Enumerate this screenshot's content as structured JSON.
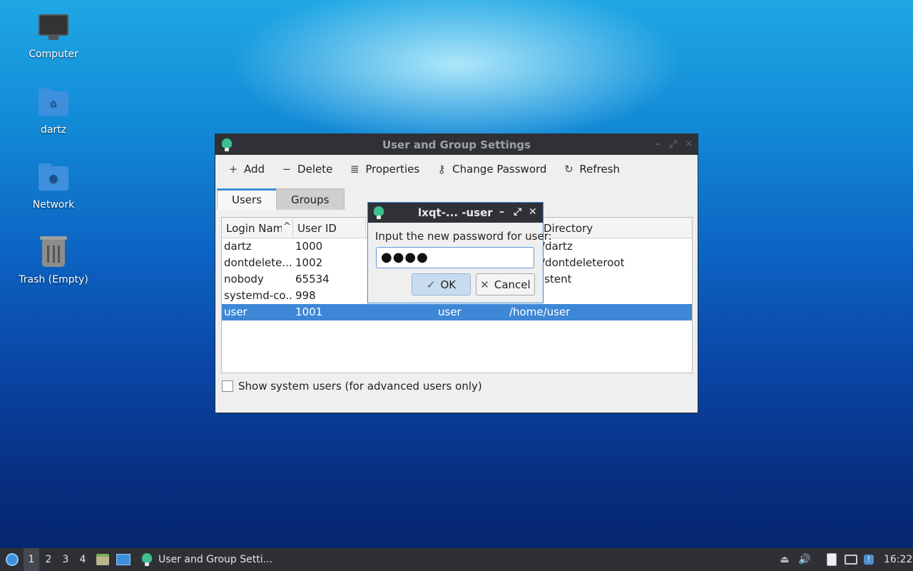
{
  "desktop": {
    "icons": [
      {
        "label": "Computer"
      },
      {
        "label": "dartz"
      },
      {
        "label": "Network"
      },
      {
        "label": "Trash (Empty)"
      }
    ]
  },
  "window": {
    "title": "User and Group Settings",
    "toolbar": {
      "add": "Add",
      "delete": "Delete",
      "properties": "Properties",
      "change_password": "Change Password",
      "refresh": "Refresh"
    },
    "tabs": [
      {
        "label": "Users",
        "active": true
      },
      {
        "label": "Groups",
        "active": false
      }
    ],
    "columns": [
      "Login Name",
      "User ID",
      "Directory"
    ],
    "rows": [
      {
        "login": "dartz",
        "uid": "1000",
        "group": "",
        "dir": "/dartz"
      },
      {
        "login": "dontdelete...",
        "uid": "1002",
        "group": "",
        "dir": "/dontdeleteroot"
      },
      {
        "login": "nobody",
        "uid": "65534",
        "group": "",
        "dir": "istent"
      },
      {
        "login": "systemd-co...",
        "uid": "998",
        "group": "",
        "dir": ""
      },
      {
        "login": "user",
        "uid": "1001",
        "group": "user",
        "dir": "/home/user",
        "selected": true
      }
    ],
    "show_system_users": "Show system users (for advanced users only)"
  },
  "dialog": {
    "title": "lxqt-... -user",
    "prompt": "Input the new password for user:",
    "password_value": "●●●●",
    "ok": "OK",
    "cancel": "Cancel"
  },
  "taskbar": {
    "desktops": [
      "1",
      "2",
      "3",
      "4"
    ],
    "active_desktop": "1",
    "task_title": "User and Group Setti...",
    "clock": "16:22"
  },
  "colors": {
    "selection": "#3e87d6",
    "titlebar": "#2f3136",
    "taskbar": "#2e3035"
  }
}
